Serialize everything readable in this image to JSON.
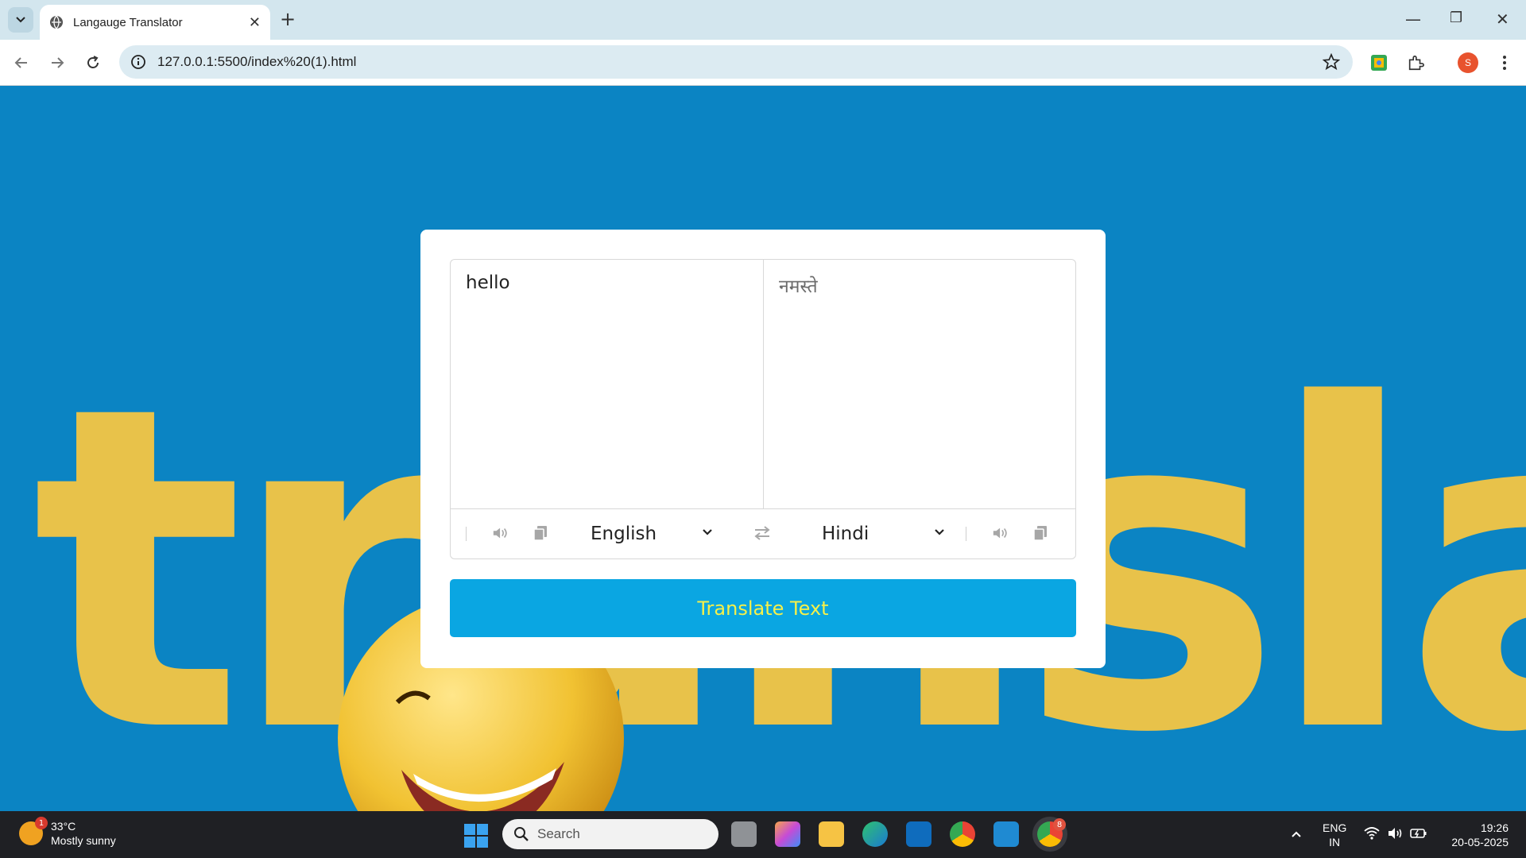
{
  "browser": {
    "tab_title": "Langauge Translator",
    "url": "127.0.0.1:5500/index%20(1).html",
    "profile_initial": "S"
  },
  "background": {
    "word": "translate"
  },
  "translator": {
    "from_text": "hello",
    "to_text": "नमस्ते",
    "from_language": "English",
    "to_language": "Hindi",
    "translate_label": "Translate Text"
  },
  "taskbar": {
    "weather_temp": "33°C",
    "weather_desc": "Mostly sunny",
    "weather_badge": "1",
    "search_label": "Search",
    "lang_line1": "ENG",
    "lang_line2": "IN",
    "time": "19:26",
    "date": "20-05-2025",
    "chrome_badge": "8"
  },
  "colors": {
    "page_bg": "#0b84c3",
    "accent": "#0aa6e2",
    "button_text": "#f5f04a",
    "art_yellow": "#e8c24a"
  }
}
